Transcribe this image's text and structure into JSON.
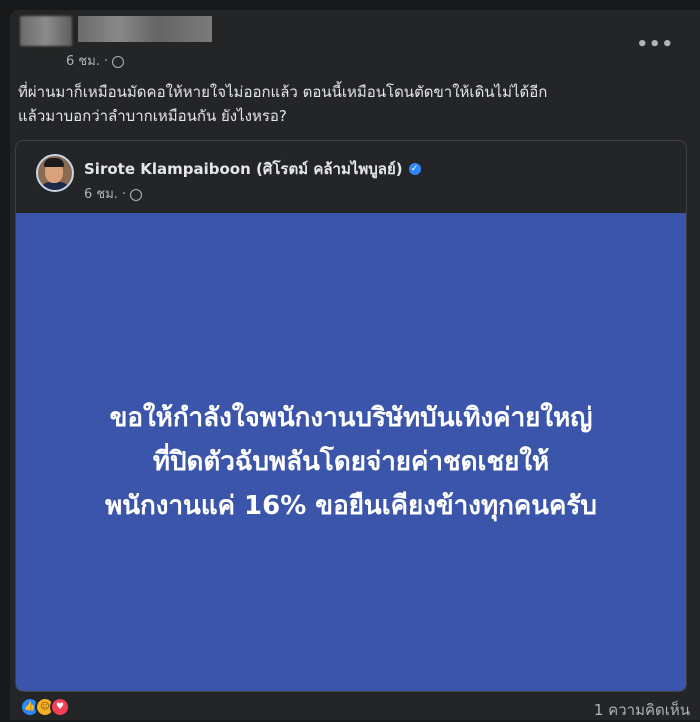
{
  "post": {
    "time": "6 ชม. ·",
    "more_label": "•••",
    "text_line1": "ที่ผ่านมาก็เหมือนมัดคอให้หายใจไม่ออกแล้ว ตอนนี้เหมือนโดนตัดขาให้เดินไม่ได้อีก",
    "text_line2": "แล้วมาบอกว่าลำบากเหมือนกัน ยังไงหรอ?"
  },
  "shared_post": {
    "author": "Sirote Klampaiboon (ศิโรตม์ คล้ามไพบูลย์)",
    "time": "6 ชม. ·",
    "image_text": {
      "line1": "ขอให้กำลังใจพนักงานบริษัทบันเทิงค่ายใหญ่",
      "line2": "ที่ปิดตัวฉับพลันโดยจ่ายค่าชดเชยให้",
      "line3": "พนักงานแค่ 16% ขอยืนเคียงข้างทุกคนครับ"
    },
    "panel_color": "#3b55aa"
  },
  "footer": {
    "reactions": [
      "like-icon",
      "care-icon",
      "love-icon"
    ],
    "comments": "1 ความคิดเห็น"
  }
}
